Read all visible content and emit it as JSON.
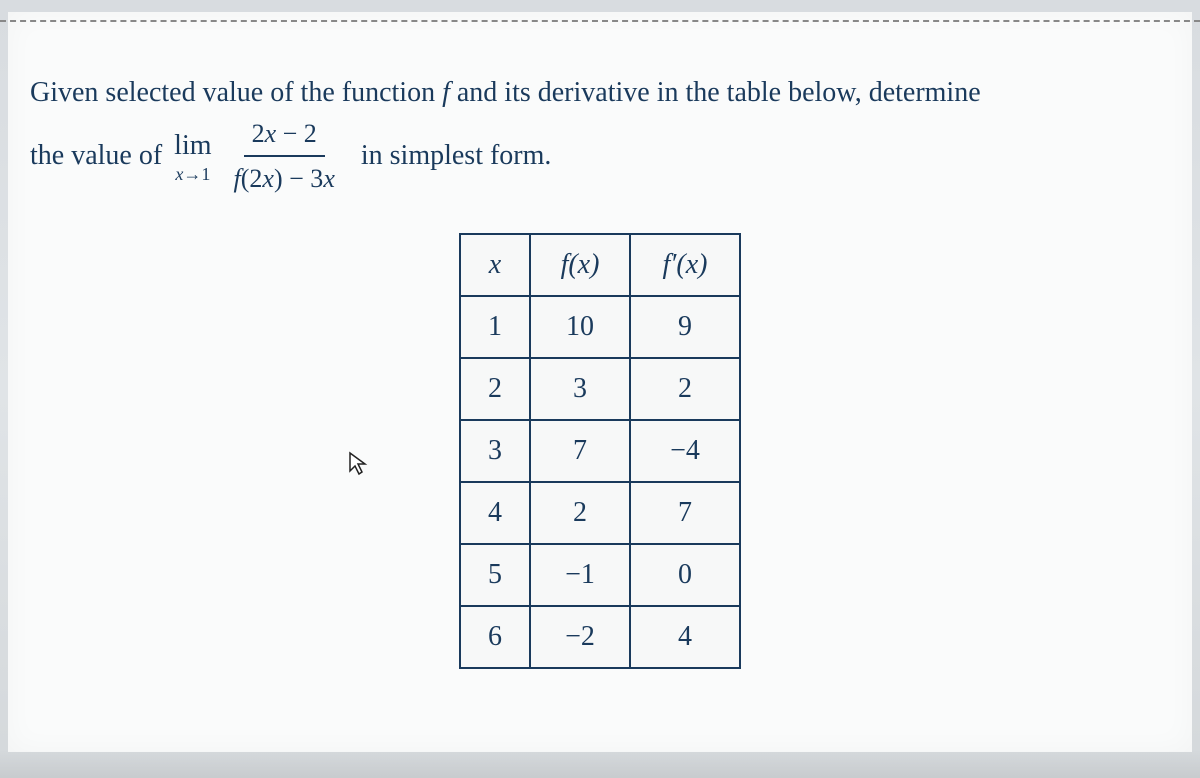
{
  "problem": {
    "line1_part1": "Given selected value of the function ",
    "line1_fvar": "f",
    "line1_part2": " and its derivative in the table below, determine",
    "line2_part1": "the value of ",
    "lim_text": "lim",
    "lim_sub_x": "x",
    "lim_sub_arrow": "→",
    "lim_sub_val": "1",
    "frac_numer": "2x − 2",
    "frac_denom_f": "f",
    "frac_denom_arg": "(2x)",
    "frac_denom_rest": " − 3x",
    "line2_part2": " in simplest form."
  },
  "table": {
    "headers": {
      "x": "x",
      "fx_f": "f",
      "fx_arg": "(x)",
      "fpx_f": "f",
      "fpx_prime": "′",
      "fpx_arg": "(x)"
    },
    "rows": [
      {
        "x": "1",
        "fx": "10",
        "fpx": "9"
      },
      {
        "x": "2",
        "fx": "3",
        "fpx": "2"
      },
      {
        "x": "3",
        "fx": "7",
        "fpx": "−4"
      },
      {
        "x": "4",
        "fx": "2",
        "fpx": "7"
      },
      {
        "x": "5",
        "fx": "−1",
        "fpx": "0"
      },
      {
        "x": "6",
        "fx": "−2",
        "fpx": "4"
      }
    ]
  },
  "chart_data": {
    "type": "table",
    "title": "Values of f and f'",
    "columns": [
      "x",
      "f(x)",
      "f'(x)"
    ],
    "data": [
      [
        1,
        10,
        9
      ],
      [
        2,
        3,
        2
      ],
      [
        3,
        7,
        -4
      ],
      [
        4,
        2,
        7
      ],
      [
        5,
        -1,
        0
      ],
      [
        6,
        -2,
        4
      ]
    ]
  }
}
